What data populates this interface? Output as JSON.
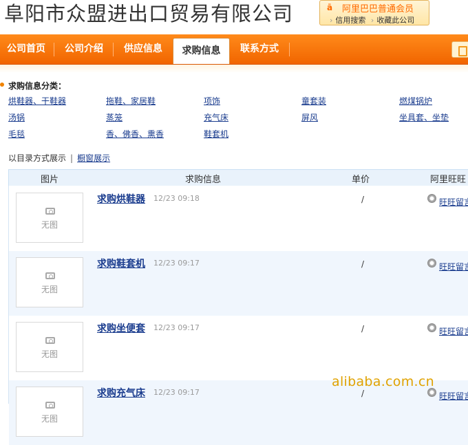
{
  "header": {
    "company_name": "阜阳市众盟进出口贸易有限公司",
    "member_badge": {
      "logo": "℃",
      "title": "阿里巴巴普通会员",
      "credit_search": "信用搜索",
      "bookmark": "收藏此公司"
    }
  },
  "nav": {
    "items": [
      {
        "label": "公司首页",
        "active": false
      },
      {
        "label": "公司介绍",
        "active": false
      },
      {
        "label": "供应信息",
        "active": false
      },
      {
        "label": "求购信息",
        "active": true
      },
      {
        "label": "联系方式",
        "active": false
      }
    ]
  },
  "categories": {
    "title": "求购信息分类：",
    "links": [
      "烘鞋器、干鞋器",
      "拖鞋、家居鞋",
      "项饰",
      "童套装",
      "燃煤锅炉",
      "汤锅",
      "蒸笼",
      "充气床",
      "屏风",
      "坐具套、坐垫",
      "毛毯",
      "香、佛香、熏香",
      "鞋套机"
    ]
  },
  "view_switch": {
    "catalog": "以目录方式展示",
    "separator": "|",
    "showcase": "橱窗展示"
  },
  "table": {
    "headers": {
      "image": "图片",
      "info": "求购信息",
      "price": "单价",
      "aliww": "阿里旺旺"
    },
    "no_image": "无图",
    "rows": [
      {
        "title": "求购烘鞋器",
        "time": "12/23 09:18",
        "price": "/",
        "ww": "旺旺留言"
      },
      {
        "title": "求购鞋套机",
        "time": "12/23 09:17",
        "price": "/",
        "ww": "旺旺留言"
      },
      {
        "title": "求购坐便套",
        "time": "12/23 09:17",
        "price": "/",
        "ww": "旺旺留言"
      },
      {
        "title": "求购充气床",
        "time": "12/23 09:17",
        "price": "/",
        "ww": "旺旺留言"
      }
    ]
  },
  "watermark": "alibaba.com.cn",
  "colors": {
    "nav_orange": "#f16500",
    "link_blue": "#1a3c8e",
    "row_alt": "#f0f6fd",
    "header_blue": "#e9f2fb"
  }
}
